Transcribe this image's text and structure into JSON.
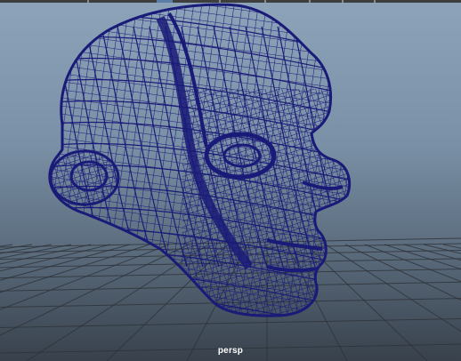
{
  "viewport": {
    "camera_name": "persp",
    "background_top": "#8da3b9",
    "background_bottom": "#38414c",
    "grid_color": "#2e3238",
    "wireframe_color": "#1a1a78"
  },
  "model": {
    "icon": "head-wireframe-mesh"
  }
}
